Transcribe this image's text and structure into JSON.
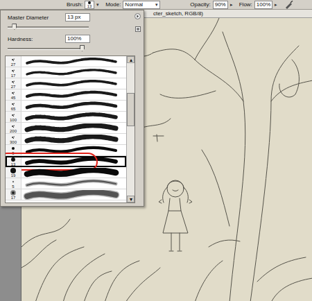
{
  "options_bar": {
    "brush_label": "Brush:",
    "brush_size": "13",
    "mode_label": "Mode:",
    "mode": "Normal",
    "opacity_label": "Opacity:",
    "opacity": "90%",
    "flow_label": "Flow:",
    "flow": "100%",
    "airbrush_on": false
  },
  "document": {
    "title": "cter_sketch, RGB/8)"
  },
  "brush_picker": {
    "diameter_label": "Master Diameter",
    "diameter": "13 px",
    "diameter_level": 0.08,
    "hardness_label": "Hardness:",
    "hardness": "100%",
    "hardness_level": 1.0,
    "scroll_level": 0.3,
    "brushes": [
      {
        "size": "27",
        "kind": "spatter",
        "selected": false,
        "annotated": false
      },
      {
        "size": "17",
        "kind": "spatter",
        "selected": false,
        "annotated": false
      },
      {
        "size": "27",
        "kind": "spatter",
        "selected": false,
        "annotated": false
      },
      {
        "size": "45",
        "kind": "spatter",
        "selected": false,
        "annotated": false
      },
      {
        "size": "65",
        "kind": "spatter",
        "selected": false,
        "annotated": false
      },
      {
        "size": "100",
        "kind": "spatter",
        "selected": false,
        "annotated": false
      },
      {
        "size": "200",
        "kind": "spatter",
        "selected": false,
        "annotated": false
      },
      {
        "size": "300",
        "kind": "spatter",
        "selected": false,
        "annotated": false
      },
      {
        "size": "9",
        "kind": "hard",
        "selected": false,
        "annotated": false
      },
      {
        "size": "13",
        "kind": "hard",
        "selected": true,
        "annotated": true
      },
      {
        "size": "19",
        "kind": "hard",
        "selected": false,
        "annotated": false
      },
      {
        "size": "5",
        "kind": "soft",
        "selected": false,
        "annotated": false
      },
      {
        "size": "17",
        "kind": "soft",
        "selected": false,
        "annotated": false
      }
    ]
  }
}
